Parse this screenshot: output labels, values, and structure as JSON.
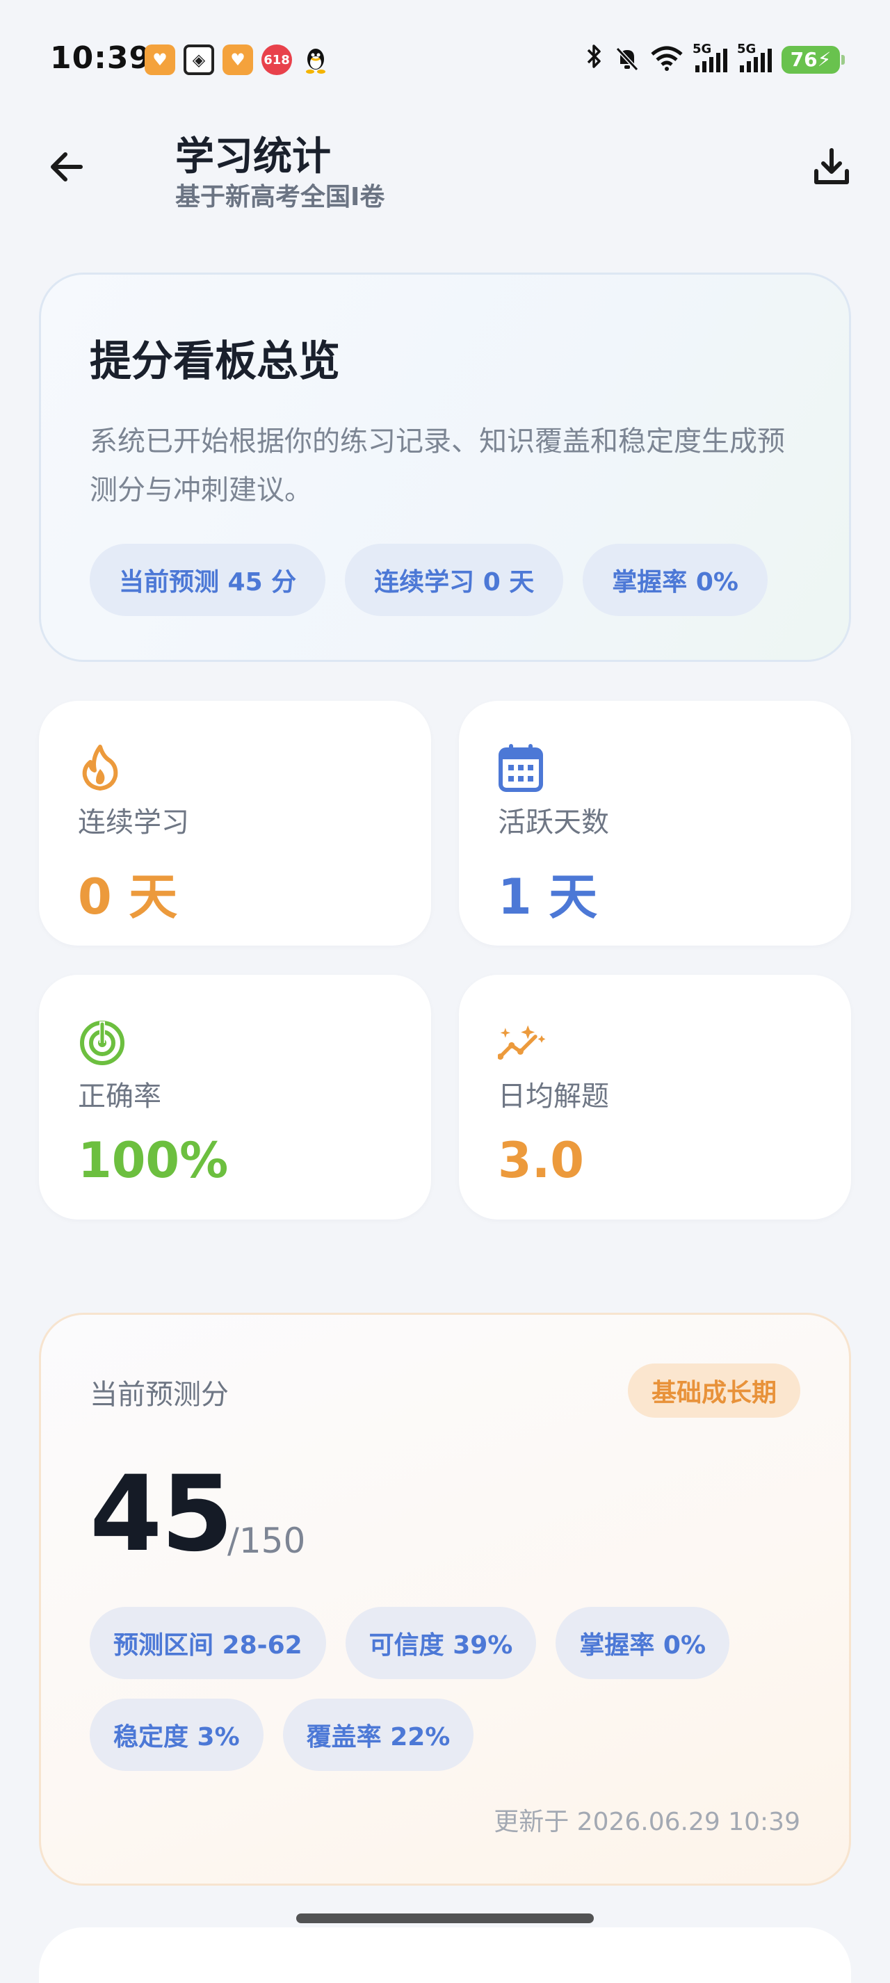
{
  "status_bar": {
    "time": "10:39",
    "app_icons": [
      "orange-app-icon",
      "grid-app-icon",
      "orange-app-icon",
      "red-618-app-icon",
      "qq-penguin-icon"
    ],
    "red_icon_text": "618",
    "network_1": "5G",
    "network_2": "5G",
    "battery": "76"
  },
  "header": {
    "title": "学习统计",
    "subtitle": "基于新高考全国I卷"
  },
  "overview": {
    "title": "提分看板总览",
    "description": "系统已开始根据你的练习记录、知识覆盖和稳定度生成预测分与冲刺建议。",
    "chips": [
      "当前预测 45 分",
      "连续学习 0 天",
      "掌握率 0%"
    ]
  },
  "stats": [
    {
      "icon": "flame-icon",
      "label": "连续学习",
      "value": "0 天",
      "color": "#ec9a3c"
    },
    {
      "icon": "calendar-icon",
      "label": "活跃天数",
      "value": "1 天",
      "color": "#4c78d6"
    },
    {
      "icon": "target-icon",
      "label": "正确率",
      "value": "100%",
      "color": "#6cbf3f"
    },
    {
      "icon": "trend-sparkle-icon",
      "label": "日均解题",
      "value": "3.0",
      "color": "#ec9a3c"
    }
  ],
  "prediction": {
    "label": "当前预测分",
    "phase": "基础成长期",
    "score": "45",
    "max": "/150",
    "chips": [
      "预测区间 28-62",
      "可信度 39%",
      "掌握率 0%",
      "稳定度 3%",
      "覆盖率 22%"
    ],
    "updated": "更新于 2026.06.29 10:39"
  }
}
